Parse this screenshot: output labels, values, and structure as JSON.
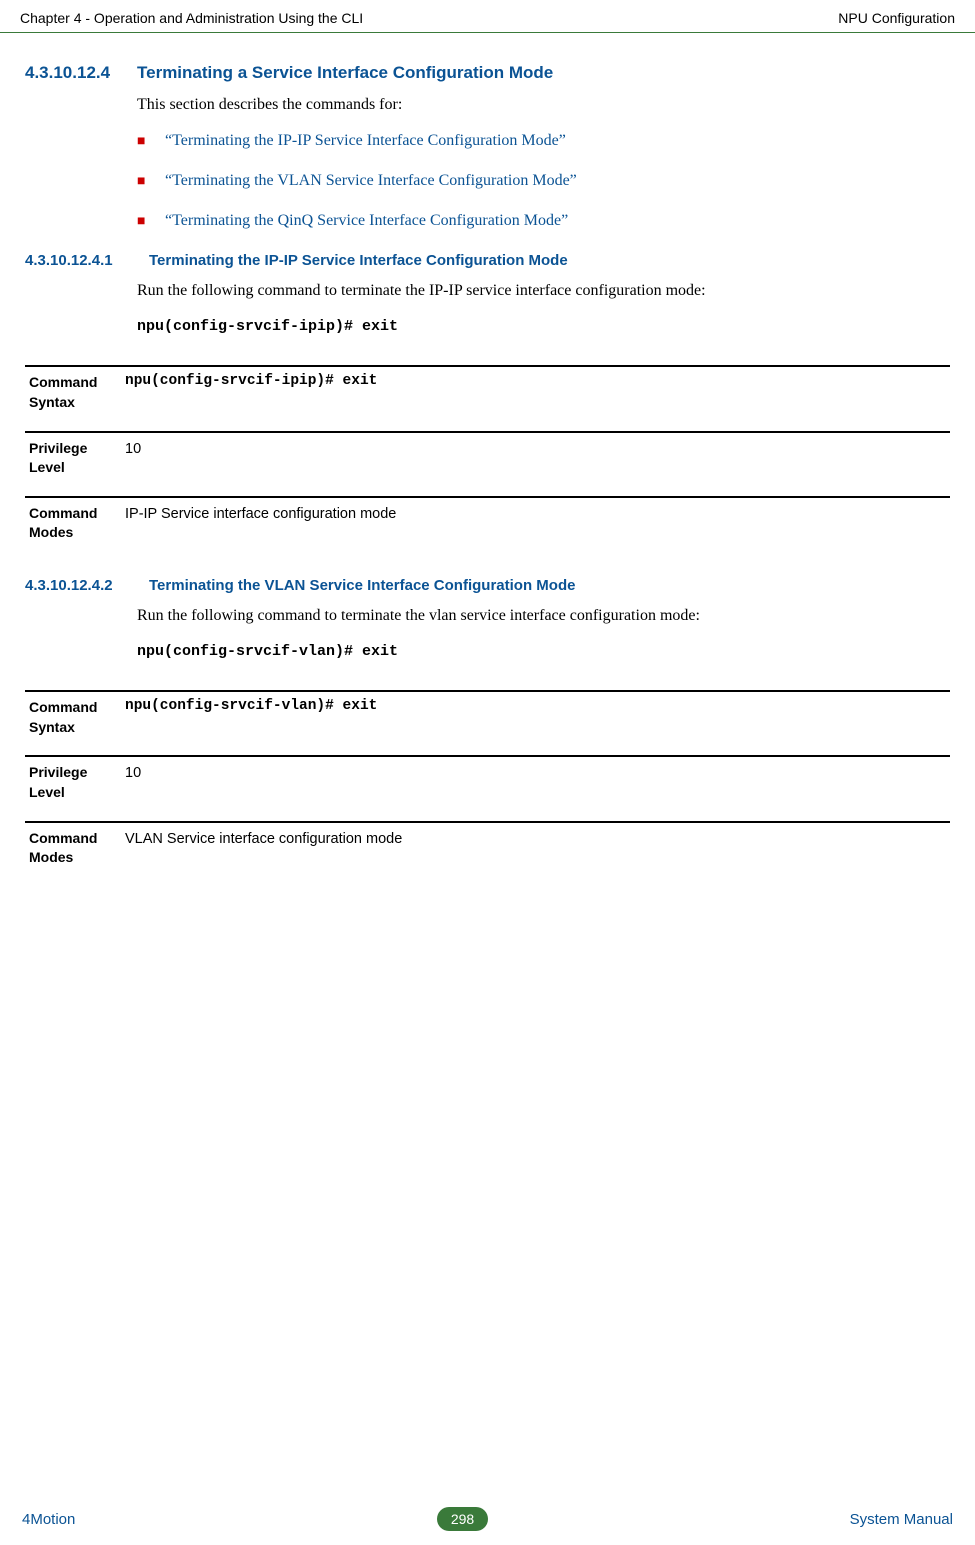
{
  "header": {
    "left": "Chapter 4 - Operation and Administration Using the CLI",
    "right": "NPU Configuration"
  },
  "section_main": {
    "num": "4.3.10.12.4",
    "title": "Terminating a Service Interface Configuration Mode",
    "intro": "This section describes the commands for:"
  },
  "links": [
    "“Terminating the IP-IP Service Interface Configuration Mode”",
    "“Terminating the VLAN Service Interface Configuration Mode”",
    "“Terminating the QinQ Service Interface Configuration Mode”"
  ],
  "sub1": {
    "num": "4.3.10.12.4.1",
    "title": "Terminating the IP-IP Service Interface Configuration Mode",
    "body": "Run the following command to terminate the IP-IP service interface configuration mode:",
    "cmd": "npu(config-srvcif-ipip)# exit",
    "syntax_label": "Command Syntax",
    "syntax_val": "npu(config-srvcif-ipip)# exit",
    "priv_label": "Privilege Level",
    "priv_val": "10",
    "modes_label": "Command Modes",
    "modes_val": "IP-IP Service interface configuration mode"
  },
  "sub2": {
    "num": "4.3.10.12.4.2",
    "title": "Terminating the VLAN Service Interface Configuration Mode",
    "body": "Run the following command to terminate the vlan service interface configuration mode:",
    "cmd": "npu(config-srvcif-vlan)# exit",
    "syntax_label": "Command Syntax",
    "syntax_val": "npu(config-srvcif-vlan)# exit",
    "priv_label": "Privilege Level",
    "priv_val": "10",
    "modes_label": "Command Modes",
    "modes_val": "VLAN Service interface configuration mode"
  },
  "footer": {
    "left": "4Motion",
    "page": "298",
    "right": "System Manual"
  }
}
